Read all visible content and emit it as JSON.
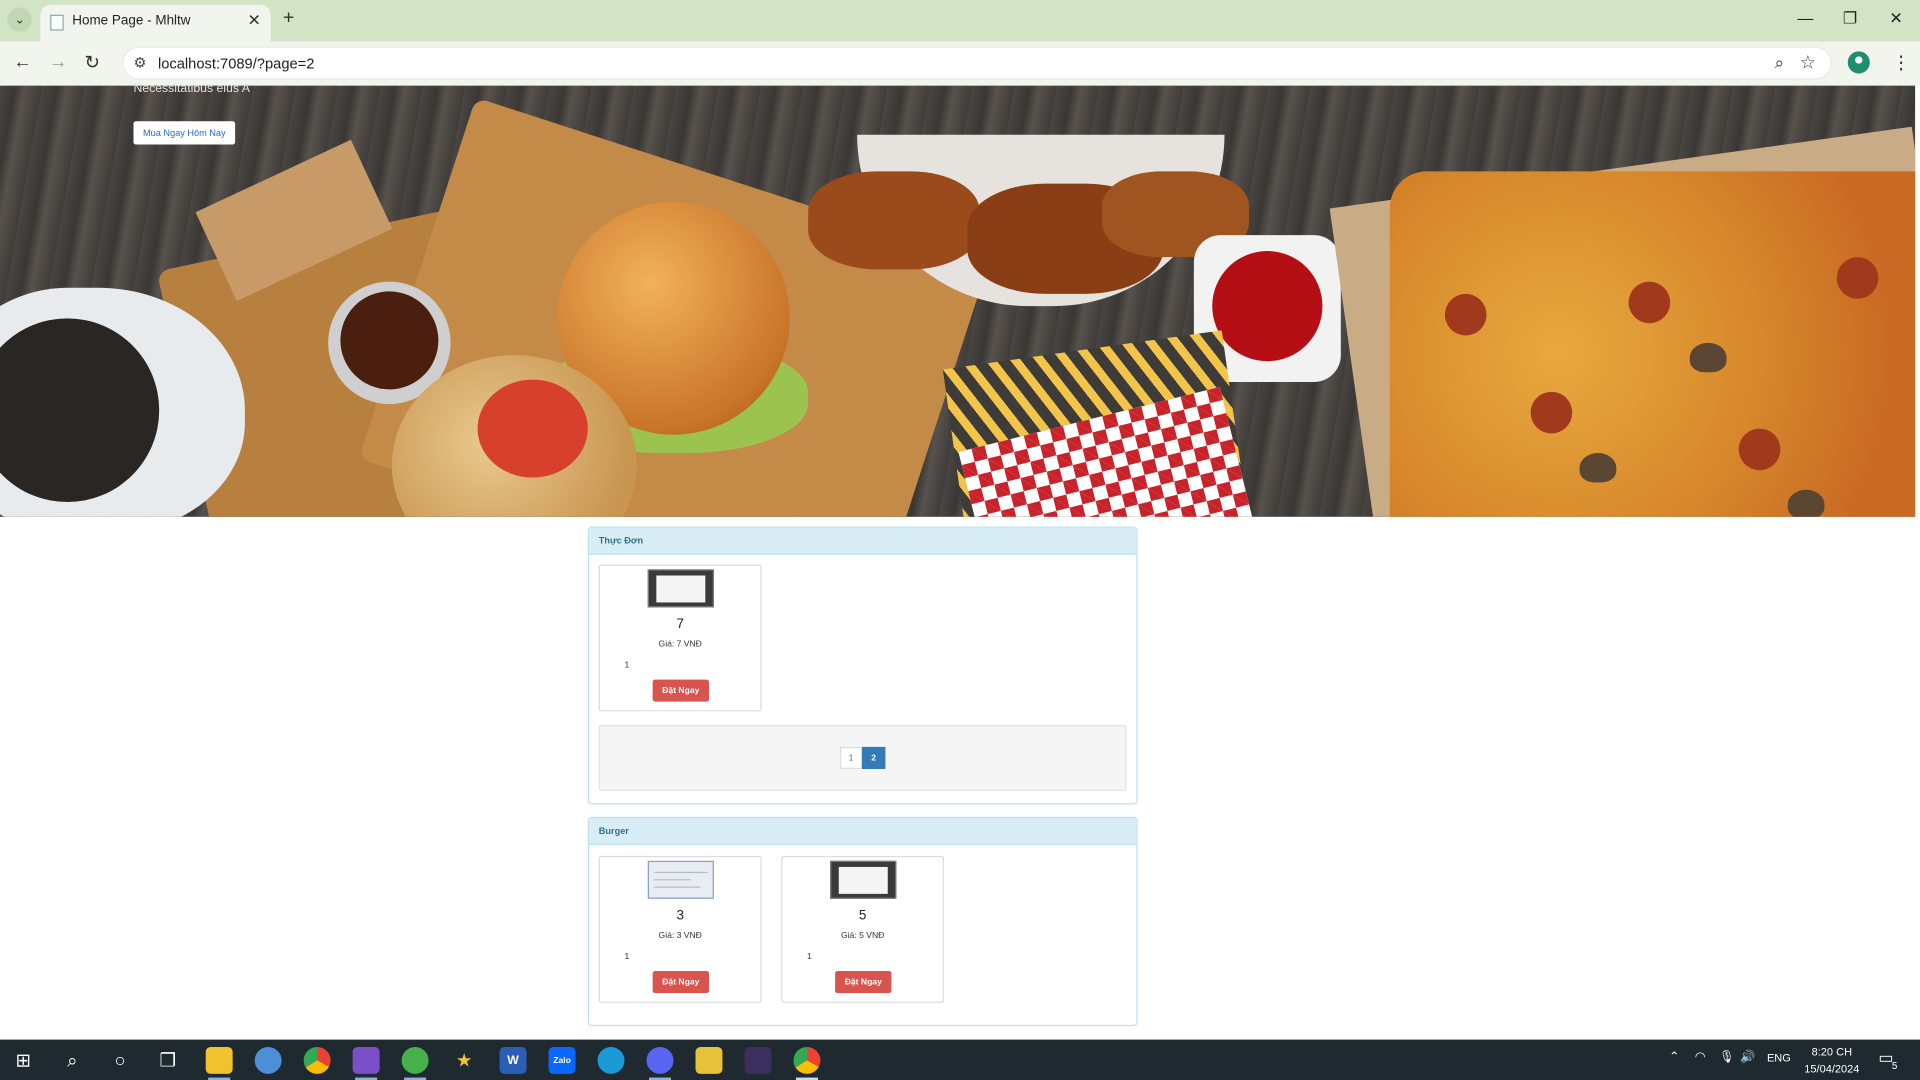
{
  "browser": {
    "tab_title": "Home Page - Mhltw",
    "url": "localhost:7089/?page=2",
    "new_tab": "+",
    "close": "✕"
  },
  "hero": {
    "caption": "Necessitatibus eius A",
    "cta_label": "Mua Ngay Hôm Nay"
  },
  "menu_section": {
    "title": "Thực Đơn",
    "products": [
      {
        "name": "7",
        "price": "Giá: 7 VNĐ",
        "qty": "1",
        "button": "Đặt Ngay"
      }
    ],
    "pagination": {
      "pages": [
        "1",
        "2"
      ],
      "current": "2"
    }
  },
  "burger_section": {
    "title": "Burger",
    "products": [
      {
        "name": "3",
        "price": "Giá: 3 VNĐ",
        "qty": "1",
        "button": "Đặt Ngay"
      },
      {
        "name": "5",
        "price": "Giá: 5 VNĐ",
        "qty": "1",
        "button": "Đặt Ngay"
      }
    ]
  },
  "taskbar": {
    "apps": [
      "start-icon",
      "search-icon",
      "cortana-icon",
      "task-view-icon",
      "file-explorer-icon",
      "paint-icon",
      "chrome-icon",
      "visual-studio-icon",
      "app-icon",
      "star-app-icon",
      "word-icon",
      "zalo-icon",
      "edge-icon",
      "discord-icon",
      "snipping-icon",
      "terminal-icon",
      "chrome-active-icon"
    ],
    "word_label": "W",
    "zalo_label": "Zalo",
    "language": "ENG",
    "time": "8:20 CH",
    "date": "15/04/2024",
    "notifications": "5"
  },
  "colors": {
    "panel_header": "#d9edf7",
    "panel_border": "#bce0f1",
    "order_button": "#d9534f",
    "active_page": "#337ab7"
  }
}
